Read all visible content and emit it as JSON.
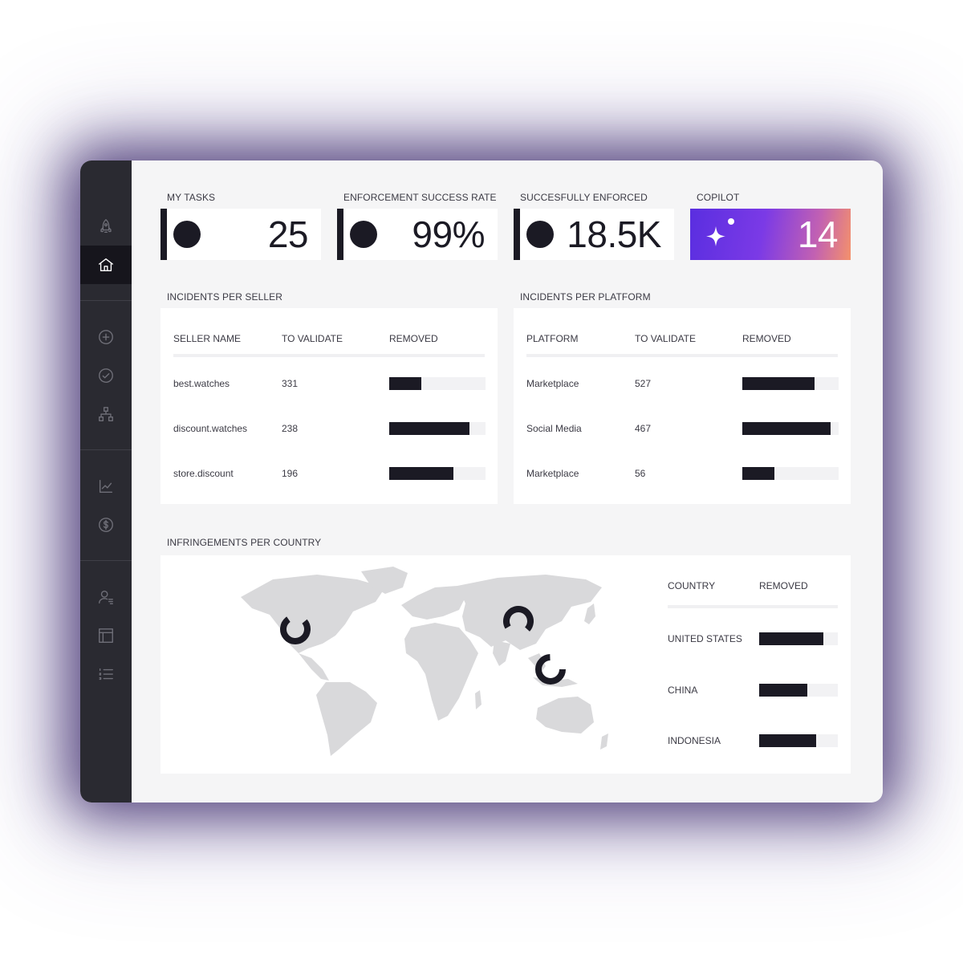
{
  "sidebar": {
    "items": [
      {
        "icon": "rocket-icon",
        "active": false
      },
      {
        "icon": "home-icon",
        "active": true
      },
      {
        "icon": "plus-circle-icon",
        "active": false
      },
      {
        "icon": "check-circle-icon",
        "active": false
      },
      {
        "icon": "hierarchy-icon",
        "active": false
      },
      {
        "icon": "line-chart-icon",
        "active": false
      },
      {
        "icon": "dollar-circle-icon",
        "active": false
      },
      {
        "icon": "user-settings-icon",
        "active": false
      },
      {
        "icon": "layout-icon",
        "active": false
      },
      {
        "icon": "list-icon",
        "active": false
      }
    ]
  },
  "kpis": {
    "tasks": {
      "label": "MY TASKS",
      "value": "25"
    },
    "success": {
      "label": "ENFORCEMENT SUCCESS RATE",
      "value": "99%"
    },
    "enforced": {
      "label": "SUCCESFULLY ENFORCED",
      "value": "18.5K"
    },
    "copilot": {
      "label": "COPILOT",
      "value": "14"
    }
  },
  "sellers": {
    "title": "INCIDENTS PER SELLER",
    "headers": {
      "name": "SELLER  NAME",
      "validate": "TO VALIDATE",
      "removed": "REMOVED"
    },
    "rows": [
      {
        "name": "best.watches",
        "validate": "331",
        "removed_fraction": 0.33
      },
      {
        "name": "discount.watches",
        "validate": "238",
        "removed_fraction": 0.83
      },
      {
        "name": "store.discount",
        "validate": "196",
        "removed_fraction": 0.67
      }
    ]
  },
  "platforms": {
    "title": "INCIDENTS PER PLATFORM",
    "headers": {
      "name": "PLATFORM",
      "validate": "TO VALIDATE",
      "removed": "REMOVED"
    },
    "rows": [
      {
        "name": "Marketplace",
        "validate": "527",
        "removed_fraction": 0.75
      },
      {
        "name": "Social Media",
        "validate": "467",
        "removed_fraction": 0.92
      },
      {
        "name": "Marketplace",
        "validate": "56",
        "removed_fraction": 0.33
      }
    ]
  },
  "countries": {
    "title": "INFRINGEMENTS PER COUNTRY",
    "headers": {
      "country": "COUNTRY",
      "removed": "REMOVED"
    },
    "rows": [
      {
        "name": "UNITED STATES",
        "removed_fraction": 0.82
      },
      {
        "name": "CHINA",
        "removed_fraction": 0.61
      },
      {
        "name": "INDONESIA",
        "removed_fraction": 0.72
      }
    ]
  },
  "colors": {
    "accent": "#1b1a24",
    "sidebar": "#2a2a31",
    "copilot_start": "#5a2ee0",
    "copilot_end": "#f4916b"
  }
}
